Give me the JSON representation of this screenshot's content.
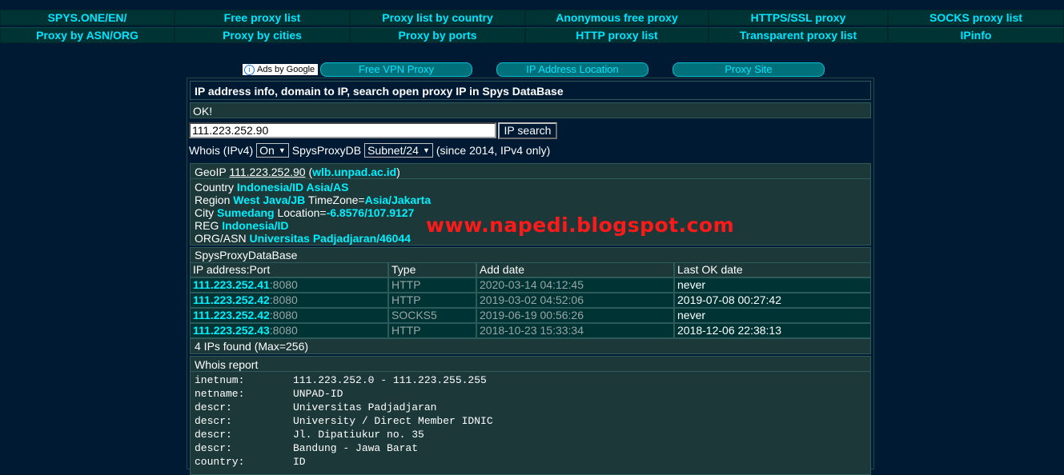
{
  "nav": {
    "row1": [
      "SPYS.ONE/EN/",
      "Free proxy list",
      "Proxy list by country",
      "Anonymous free proxy",
      "HTTPS/SSL proxy",
      "SOCKS proxy list"
    ],
    "row2": [
      "Proxy by ASN/ORG",
      "Proxy by cities",
      "Proxy by ports",
      "HTTP proxy list",
      "Transparent proxy list",
      "IPinfo"
    ]
  },
  "ads": {
    "choice": "Ads by Google",
    "buttons": [
      "Free VPN Proxy",
      "IP Address Location",
      "Proxy Site"
    ]
  },
  "header": {
    "title": "IP address info, domain to IP, search open proxy IP in Spys DataBase"
  },
  "status": "OK!",
  "search": {
    "value": "111.223.252.90",
    "button": "IP search"
  },
  "options": {
    "whois_label": "Whois (IPv4)",
    "whois_value": "On",
    "db_label": "SpysProxyDB",
    "db_value": "Subnet/24",
    "note": "(since 2014, IPv4 only)"
  },
  "geo": {
    "label": "GeoIP",
    "ip": "111.223.252.90",
    "host": "wlb.unpad.ac.id",
    "country_label": "Country",
    "country": "Indonesia/ID Asia/AS",
    "region_label": "Region",
    "region": "West Java/JB",
    "timezone_label": "TimeZone=",
    "timezone": "Asia/Jakarta",
    "city_label": "City",
    "city": "Sumedang",
    "location_label": "Location=",
    "location": "-6.8576/107.9127",
    "reg_label": "REG",
    "reg": "Indonesia/ID",
    "org_label": "ORG/ASN",
    "org": "Universitas Padjadjaran/46044"
  },
  "proxydb": {
    "title": "SpysProxyDataBase",
    "columns": [
      "IP address:Port",
      "Type",
      "Add date",
      "Last OK date"
    ],
    "rows": [
      {
        "ip": "111.223.252.41",
        "port": ":8080",
        "type": "HTTP",
        "added": "2020-03-14 04:12:45",
        "last_ok": "never"
      },
      {
        "ip": "111.223.252.42",
        "port": ":8080",
        "type": "HTTP",
        "added": "2019-03-02 04:52:06",
        "last_ok": "2019-07-08 00:27:42"
      },
      {
        "ip": "111.223.252.42",
        "port": ":8080",
        "type": "SOCKS5",
        "added": "2019-06-19 00:56:26",
        "last_ok": "never"
      },
      {
        "ip": "111.223.252.43",
        "port": ":8080",
        "type": "HTTP",
        "added": "2018-10-23 15:33:34",
        "last_ok": "2018-12-06 22:38:13"
      }
    ],
    "found": "4 IPs found (Max=256)"
  },
  "whois": {
    "title": "Whois report",
    "lines": [
      {
        "key": "inetnum:",
        "value": "111.223.252.0 - 111.223.255.255"
      },
      {
        "key": "netname:",
        "value": "UNPAD-ID"
      },
      {
        "key": "descr:",
        "value": "Universitas Padjadjaran"
      },
      {
        "key": "descr:",
        "value": "University / Direct Member IDNIC"
      },
      {
        "key": "descr:",
        "value": "Jl. Dipatiukur no. 35"
      },
      {
        "key": "descr:",
        "value": "Bandung - Jawa Barat"
      },
      {
        "key": "country:",
        "value": "ID"
      }
    ]
  },
  "watermark": "www.napedi.blogspot.com"
}
